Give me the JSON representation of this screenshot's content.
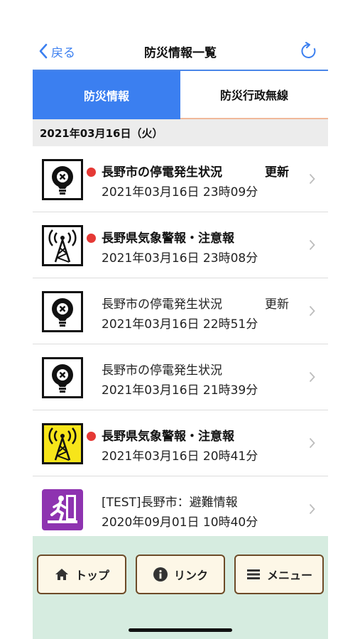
{
  "header": {
    "back_label": "戻る",
    "title": "防災情報一覧"
  },
  "tabs": [
    {
      "label": "防災情報",
      "active": true
    },
    {
      "label": "防災行政無線",
      "active": false
    }
  ],
  "date_header": "2021年03月16日（火）",
  "items": [
    {
      "icon": "blackout-bulb-icon",
      "unread": true,
      "title": "長野市の停電発生状況",
      "update_label": "更新",
      "datetime": "2021年03月16日 23時09分"
    },
    {
      "icon": "antenna-tower-icon",
      "unread": true,
      "title": "長野県気象警報・注意報",
      "update_label": "",
      "datetime": "2021年03月16日 23時08分"
    },
    {
      "icon": "blackout-bulb-icon",
      "unread": false,
      "title": "長野市の停電発生状況",
      "update_label": "更新",
      "datetime": "2021年03月16日 22時51分"
    },
    {
      "icon": "blackout-bulb-icon",
      "unread": false,
      "title": "長野市の停電発生状況",
      "update_label": "",
      "datetime": "2021年03月16日 21時39分"
    },
    {
      "icon": "antenna-tower-yellow-icon",
      "unread": true,
      "title": "長野県気象警報・注意報",
      "update_label": "",
      "datetime": "2021年03月16日 20時41分"
    },
    {
      "icon": "evacuation-icon",
      "unread": false,
      "title": "[TEST]長野市：避難情報",
      "update_label": "",
      "datetime": "2020年09月01日 10時40分"
    }
  ],
  "bottom_nav": {
    "top_label": "トップ",
    "link_label": "リンク",
    "menu_label": "メニュー"
  },
  "colors": {
    "accent": "#3b7ff0",
    "unread_dot": "#e53935",
    "bottom_bg": "#d6ece0",
    "button_bg": "#fdf7e7",
    "button_border": "#6d4b28",
    "warning_yellow": "#f7e51a",
    "evacuation_purple": "#8e33b0"
  }
}
